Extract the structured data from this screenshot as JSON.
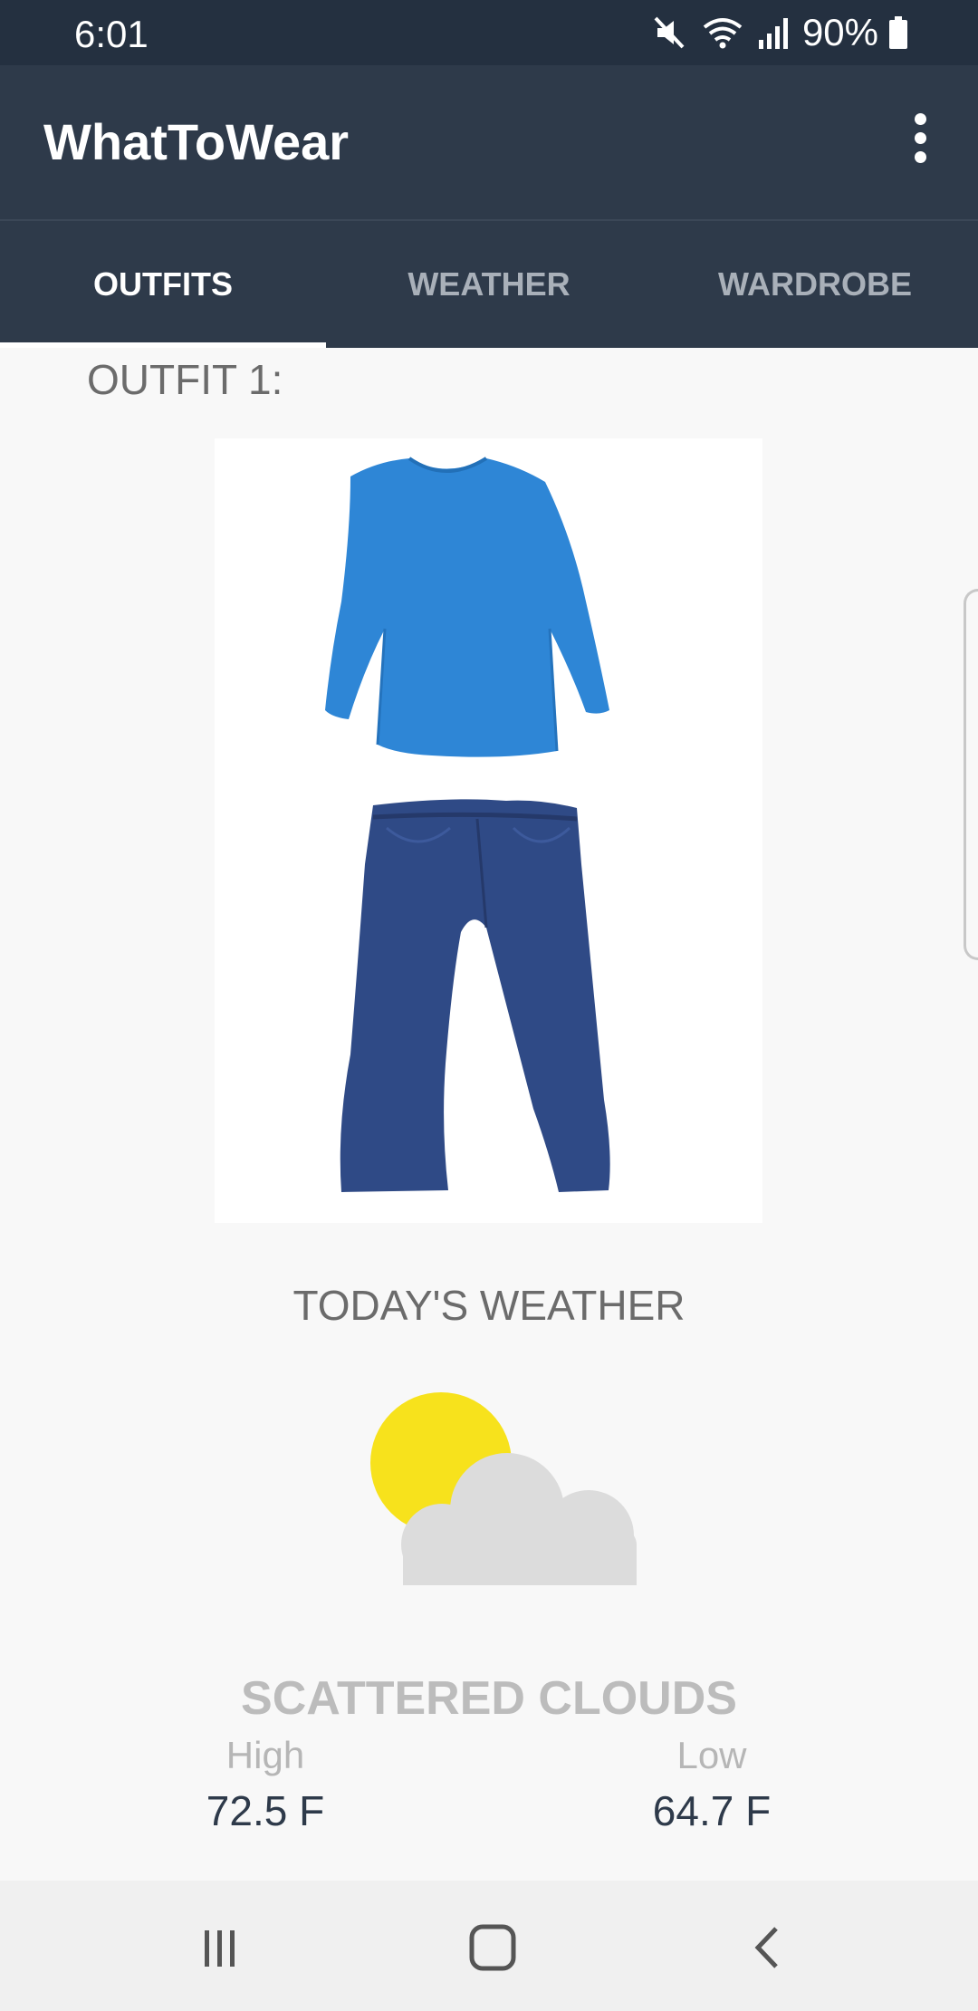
{
  "status_bar": {
    "time": "6:01",
    "battery": "90%",
    "icons": [
      "mute-icon",
      "wifi-icon",
      "signal-icon",
      "battery-icon"
    ]
  },
  "app_bar": {
    "title": "WhatToWear",
    "menu_icon": "more-vert-icon"
  },
  "tabs": [
    {
      "label": "OUTFITS",
      "active": true
    },
    {
      "label": "WEATHER",
      "active": false
    },
    {
      "label": "WARDROBE",
      "active": false
    }
  ],
  "outfit": {
    "label": "OUTFIT 1:",
    "items": [
      {
        "icon": "blue-long-sleeve-shirt-icon",
        "color": "#2e86d6"
      },
      {
        "icon": "blue-jeans-icon",
        "color": "#2f4a86"
      }
    ]
  },
  "weather": {
    "title": "TODAY'S WEATHER",
    "icon": "partly-cloudy-icon",
    "description": "SCATTERED CLOUDS",
    "high_label": "High",
    "high_value": "72.5 F",
    "low_label": "Low",
    "low_value": "64.7 F"
  },
  "nav_bar": {
    "icons": [
      "recents-icon",
      "home-icon",
      "back-icon"
    ]
  },
  "colors": {
    "app_bar": "#2e3a4a",
    "status_bar": "#243040",
    "background": "#f8f8f8",
    "sun": "#f7e21c",
    "cloud": "#dcdcdc"
  }
}
